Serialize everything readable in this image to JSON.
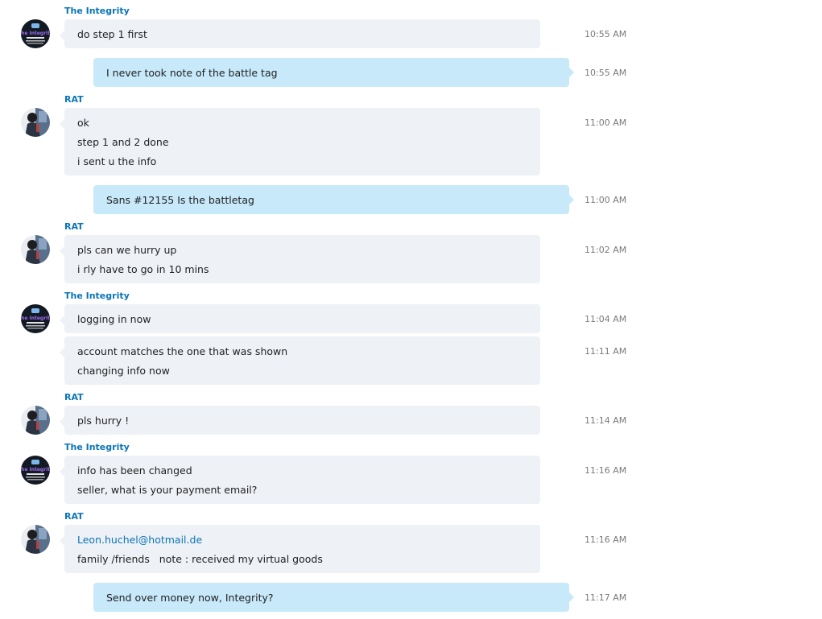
{
  "chat": {
    "participants": {
      "integrity": "The Integrity",
      "rat": "RAT"
    },
    "messages": [
      {
        "sender": "The Integrity",
        "time": "10:55 AM",
        "lines": [
          "do step 1 first"
        ]
      },
      {
        "sender": "",
        "time": "10:55 AM",
        "lines": [
          "I never took note of the battle tag"
        ]
      },
      {
        "sender": "RAT",
        "time": "11:00 AM",
        "lines": [
          "ok",
          "step 1 and 2 done",
          "i sent u the info"
        ]
      },
      {
        "sender": "",
        "time": "11:00 AM",
        "lines": [
          "Sans #12155 Is the battletag"
        ]
      },
      {
        "sender": "RAT",
        "time": "11:02 AM",
        "lines": [
          "pls can we hurry up",
          "i rly have to go in 10 mins"
        ]
      },
      {
        "sender": "The Integrity",
        "time": "11:04 AM",
        "lines": [
          "logging in now"
        ]
      },
      {
        "sender": "The Integrity",
        "time": "11:11 AM",
        "lines": [
          "account matches the one that was shown",
          "changing info now"
        ]
      },
      {
        "sender": "RAT",
        "time": "11:14 AM",
        "lines": [
          "pls hurry !"
        ]
      },
      {
        "sender": "The Integrity",
        "time": "11:16 AM",
        "lines": [
          "info has been changed",
          "seller, what is your payment email?"
        ]
      },
      {
        "sender": "RAT",
        "time": "11:16 AM",
        "lines": [
          "Leon.huchel@hotmail.de",
          "family /friends   note : received my virtual goods"
        ]
      },
      {
        "sender": "",
        "time": "11:17 AM",
        "lines": [
          "Send over money now, Integrity?"
        ]
      }
    ]
  },
  "avatars": {
    "integrity_logo_text": [
      "The Integrity",
      "Official Middleman"
    ],
    "colors": {
      "integrity_bg": "#141a24",
      "integrity_accent": "#7b4fd6",
      "rat_bg": "#2b3442"
    }
  },
  "colors": {
    "sender_name": "#0b75b8",
    "incoming_bubble": "#eef1f6",
    "outgoing_bubble": "#c7e9fa",
    "timestamp": "#7a7a7a",
    "link": "#0b75b8"
  }
}
